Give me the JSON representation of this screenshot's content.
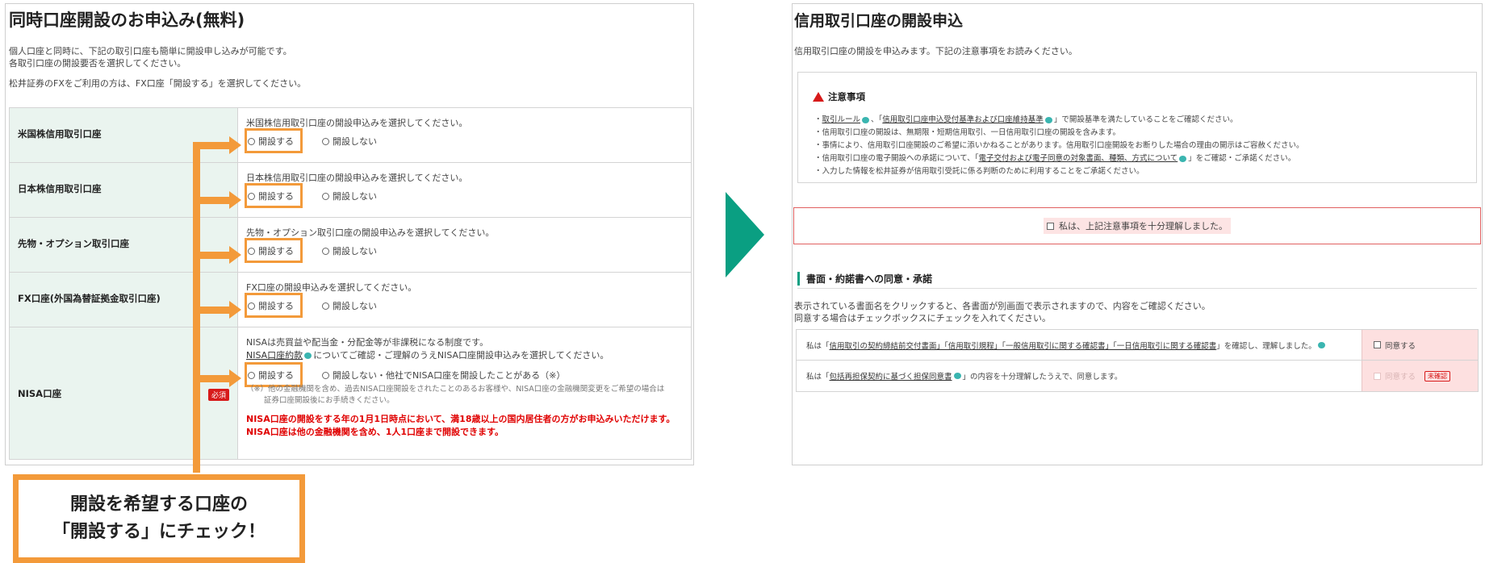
{
  "left": {
    "title": "同時口座開設のお申込み(無料)",
    "intro1": "個人口座と同時に、下記の取引口座も簡単に開設申し込みが可能です。",
    "intro2": "各取引口座の開設要否を選択してください。",
    "intro3": "松井証券のFXをご利用の方は、FX口座「開設する」を選択してください。",
    "rows": [
      {
        "label": "米国株信用取引口座",
        "question": "米国株信用取引口座の開設申込みを選択してください。",
        "open": "開設する",
        "not_open": "開設しない"
      },
      {
        "label": "日本株信用取引口座",
        "question": "日本株信用取引口座の開設申込みを選択してください。",
        "open": "開設する",
        "not_open": "開設しない"
      },
      {
        "label": "先物・オプション取引口座",
        "question": "先物・オプション取引口座の開設申込みを選択してください。",
        "open": "開設する",
        "not_open": "開設しない"
      },
      {
        "label": "FX口座(外国為替証拠金取引口座)",
        "question": "FX口座の開設申込みを選択してください。",
        "open": "開設する",
        "not_open": "開設しない"
      }
    ],
    "nisa": {
      "label": "NISA口座",
      "required": "必須",
      "line1": "NISAは売買益や配当金・分配金等が非課税になる制度です。",
      "line2_link": "NISA口座約款",
      "line2_rest": "についてご確認・ご理解のうえNISA口座開設申込みを選択してください。",
      "open": "開設する",
      "not_open": "開設しない・他社でNISA口座を開設したことがある（※）",
      "note1": "（※）他の金融機関を含め、過去NISA口座開設をされたことのあるお客様や、NISA口座の金融機関変更をご希望の場合は",
      "note2": "証券口座開設後にお手続きください。",
      "warn1": "NISA口座の開設をする年の1月1日時点において、満18歳以上の国内居住者の方がお申込みいただけます。",
      "warn2": "NISA口座は他の金融機関を含め、1人1口座まで開設できます。"
    },
    "callout_line1": "開設を希望する口座の",
    "callout_line2": "「開設する」にチェック！"
  },
  "right": {
    "title": "信用取引口座の開設申込",
    "intro": "信用取引口座の開設を申込みます。下記の注意事項をお読みください。",
    "notice_title": "注意事項",
    "notice_items": [
      {
        "pre": "・",
        "link1": "取引ルール",
        "mid": "、「",
        "link2": "信用取引口座申込受付基準および口座維持基準",
        "post": "」で開設基準を満たしていることをご確認ください。"
      },
      {
        "pre": "・信用取引口座の開設は、無期限・短期信用取引、一日信用取引口座の開設を含みます。"
      },
      {
        "pre": "・事情により、信用取引口座開設のご希望に添いかねることがあります。信用取引口座開設をお断りした場合の理由の開示はご容赦ください。"
      },
      {
        "pre": "・信用取引口座の電子開設への承諾について、「",
        "link1": "電子交付および電子同意の対象書面、種類、方式について",
        "post": "」をご確認・ご承諾ください。"
      },
      {
        "pre": "・入力した情報を松井証券が信用取引受託に係る判断のために利用することをご承諾ください。"
      }
    ],
    "agree_all": "私は、上記注意事項を十分理解しました。",
    "section_title": "書面・約諾書への同意・承諾",
    "section_intro1": "表示されている書面名をクリックすると、各書面が別画面で表示されますので、内容をご確認ください。",
    "section_intro2": "同意する場合はチェックボックスにチェックを入れてください。",
    "doc_rows": [
      {
        "pre": "私は「",
        "links": "信用取引の契約締結前交付書面」「信用取引規程」「一般信用取引に関する確認書」「一日信用取引に関する確認書",
        "post": "」を確認し、理解しました。",
        "agree": "同意する",
        "unconfirmed": ""
      },
      {
        "pre": "私は「",
        "links": "包括再担保契約に基づく担保同意書",
        "post": "」の内容を十分理解したうえで、同意します。",
        "agree": "同意する",
        "unconfirmed": "未確認"
      }
    ]
  },
  "colors": {
    "accent_orange": "#f39a3a",
    "arrow_green": "#0a9f82",
    "warn_red": "#e00000",
    "table_head_bg": "#eaf4ef"
  }
}
